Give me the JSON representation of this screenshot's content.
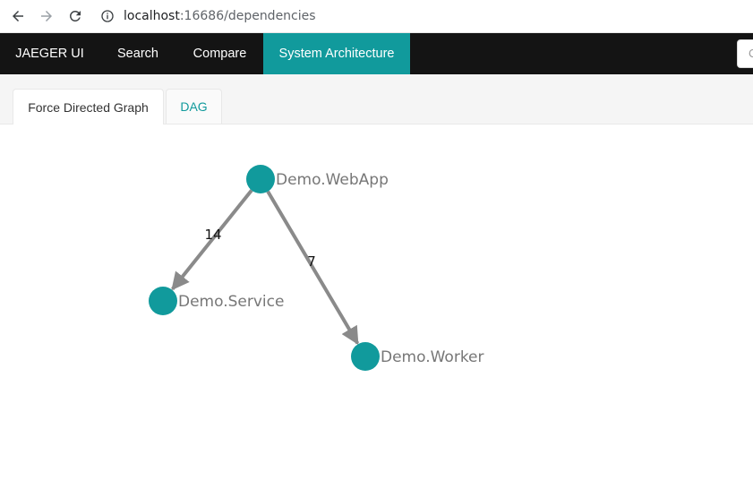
{
  "browser": {
    "url_host": "localhost",
    "url_rest": ":16686/dependencies"
  },
  "topnav": {
    "brand": "JAEGER UI",
    "items": [
      {
        "label": "Search"
      },
      {
        "label": "Compare"
      },
      {
        "label": "System Architecture",
        "active": true
      }
    ],
    "search_placeholder": "C"
  },
  "tabs": [
    {
      "label": "Force Directed Graph",
      "active": true
    },
    {
      "label": "DAG",
      "active": false
    }
  ],
  "graph": {
    "nodes": [
      {
        "id": "webapp",
        "label": "Demo.WebApp"
      },
      {
        "id": "service",
        "label": "Demo.Service"
      },
      {
        "id": "worker",
        "label": "Demo.Worker"
      }
    ],
    "edges": [
      {
        "from": "webapp",
        "to": "service",
        "label": "14"
      },
      {
        "from": "webapp",
        "to": "worker",
        "label": "7"
      }
    ],
    "colors": {
      "node": "#119a9c",
      "edge": "#8a8a8a",
      "accent": "#119a9c"
    }
  }
}
